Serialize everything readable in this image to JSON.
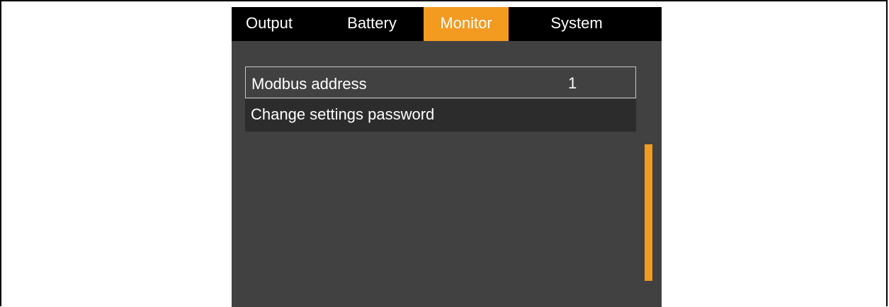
{
  "tabs": [
    {
      "label": "Output",
      "active": false
    },
    {
      "label": "Battery",
      "active": false
    },
    {
      "label": "Monitor",
      "active": true
    },
    {
      "label": "System",
      "active": false
    }
  ],
  "menu": {
    "items": [
      {
        "label": "Modbus address",
        "value": "1",
        "selected": true
      },
      {
        "label": "Change settings password",
        "value": "",
        "selected": false
      }
    ]
  },
  "scrollbar": {
    "position_fraction": 0.4
  },
  "colors": {
    "accent": "#f39a20",
    "screen_bg": "#414141",
    "tabbar_bg": "#000000",
    "row_dark_bg": "#2c2c2c",
    "text": "#ffffff"
  }
}
